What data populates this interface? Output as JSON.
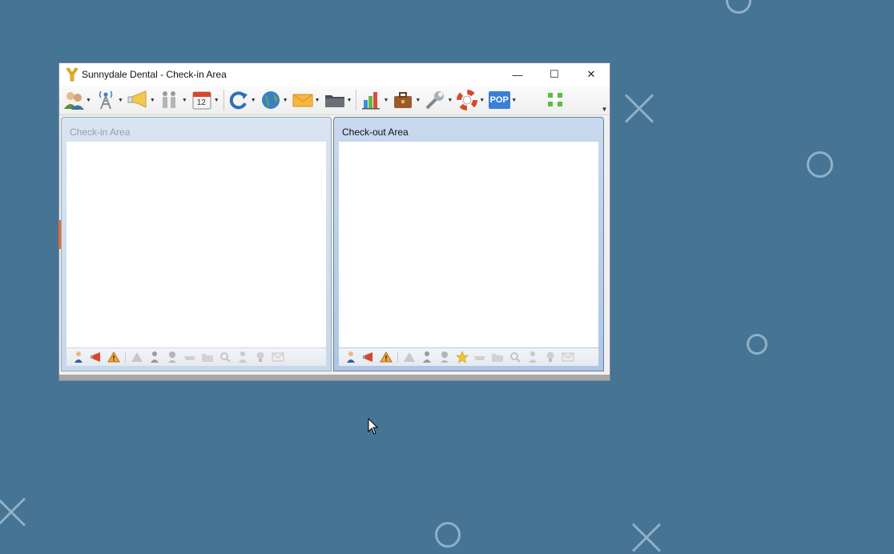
{
  "window": {
    "title": "Sunnydale Dental - Check-in Area",
    "controls": {
      "minimize": "—",
      "maximize": "☐",
      "close": "✕"
    }
  },
  "toolbar": {
    "items": [
      {
        "icon": "patients-icon"
      },
      {
        "icon": "broadcast-tower-icon"
      },
      {
        "icon": "megaphone-icon"
      },
      {
        "icon": "family-icon"
      },
      {
        "icon": "calendar-icon",
        "label": "12"
      },
      {
        "icon": "refresh-icon"
      },
      {
        "icon": "globe-icon"
      },
      {
        "icon": "mail-icon"
      },
      {
        "icon": "folder-icon"
      },
      {
        "icon": "bar-chart-icon"
      },
      {
        "icon": "briefcase-icon"
      },
      {
        "icon": "wrench-icon"
      },
      {
        "icon": "lifebuoy-icon"
      },
      {
        "icon": "pop-icon",
        "label": "POP"
      },
      {
        "icon": "grid-icon"
      }
    ]
  },
  "panes": [
    {
      "title": "Check-in Area",
      "state": "inactive"
    },
    {
      "title": "Check-out Area",
      "state": "active"
    }
  ],
  "colors": {
    "desktop": "#457495",
    "accent_blue": "#2f6fb7",
    "warning_orange": "#e8682f"
  }
}
